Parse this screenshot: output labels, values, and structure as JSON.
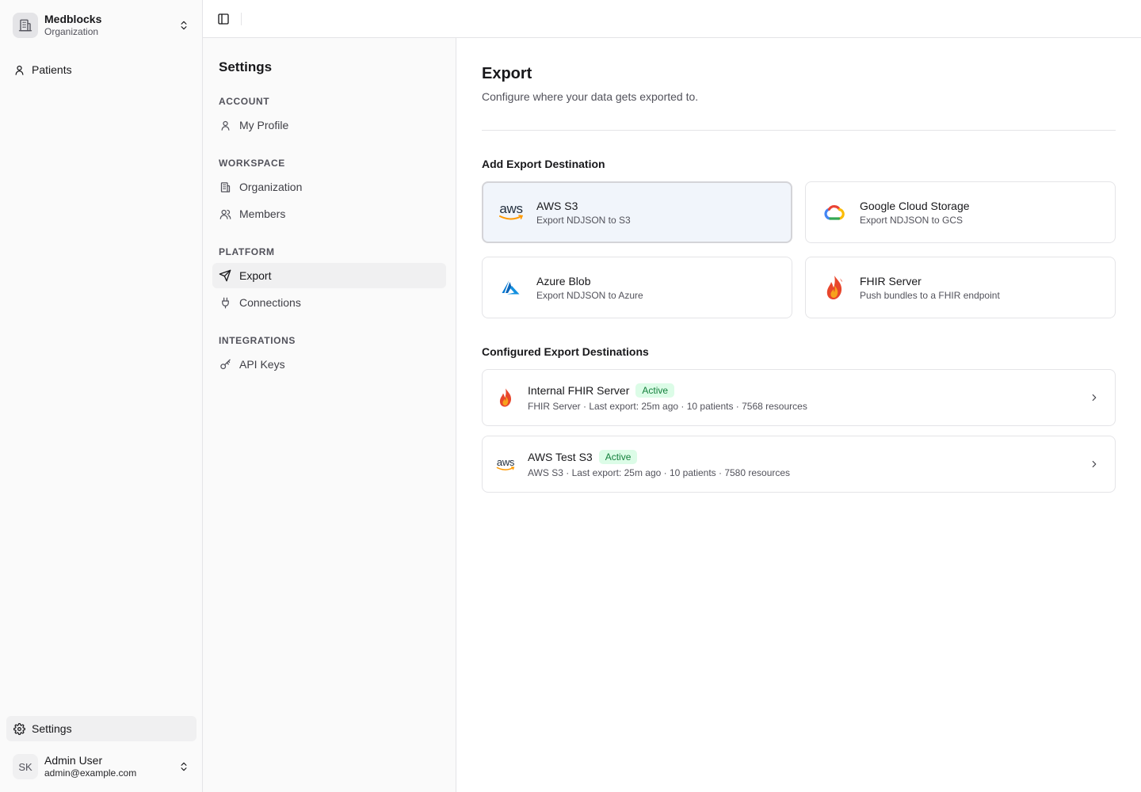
{
  "org": {
    "name": "Medblocks",
    "subtitle": "Organization"
  },
  "sidebar": {
    "items": [
      {
        "label": "Patients",
        "icon": "user-icon"
      }
    ],
    "footer_item": {
      "label": "Settings",
      "icon": "gear-icon"
    }
  },
  "user": {
    "initials": "SK",
    "name": "Admin User",
    "email": "admin@example.com"
  },
  "settings": {
    "title": "Settings",
    "groups": [
      {
        "label": "ACCOUNT",
        "items": [
          {
            "label": "My Profile",
            "icon": "user-icon"
          }
        ]
      },
      {
        "label": "WORKSPACE",
        "items": [
          {
            "label": "Organization",
            "icon": "building-icon"
          },
          {
            "label": "Members",
            "icon": "users-icon"
          }
        ]
      },
      {
        "label": "PLATFORM",
        "items": [
          {
            "label": "Export",
            "icon": "send-icon",
            "active": true
          },
          {
            "label": "Connections",
            "icon": "plug-icon"
          }
        ]
      },
      {
        "label": "INTEGRATIONS",
        "items": [
          {
            "label": "API Keys",
            "icon": "key-icon"
          }
        ]
      }
    ]
  },
  "page": {
    "title": "Export",
    "subtitle": "Configure where your data gets exported to.",
    "add_section_title": "Add Export Destination",
    "configured_section_title": "Configured Export Destinations"
  },
  "destinations": [
    {
      "name": "AWS S3",
      "desc": "Export NDJSON to S3",
      "logo_text": "aws"
    },
    {
      "name": "Google Cloud Storage",
      "desc": "Export NDJSON to GCS"
    },
    {
      "name": "Azure Blob",
      "desc": "Export NDJSON to Azure"
    },
    {
      "name": "FHIR Server",
      "desc": "Push bundles to a FHIR endpoint"
    }
  ],
  "configured": [
    {
      "name": "Internal FHIR Server",
      "status": "Active",
      "meta": "FHIR Server · Last export: 25m ago · 10 patients · 7568 resources"
    },
    {
      "name": "AWS Test S3",
      "status": "Active",
      "meta": "AWS S3 · Last export: 25m ago · 10 patients · 7580 resources",
      "logo_text": "aws"
    }
  ],
  "colors": {
    "accent_green": "#15803d",
    "badge_bg": "#dcfce7",
    "selected_card_bg": "#f1f5fb"
  }
}
